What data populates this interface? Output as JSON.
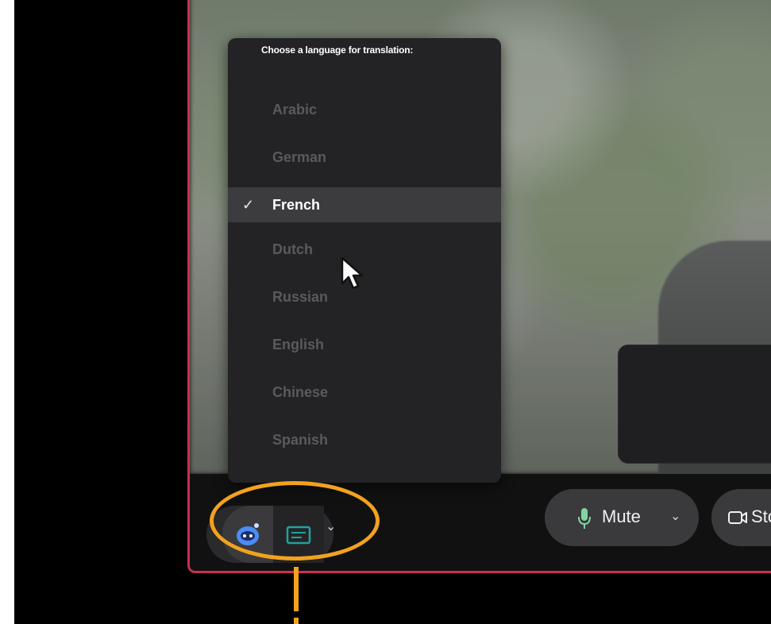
{
  "language_menu": {
    "title": "Choose a language for translation:",
    "languages": [
      {
        "label": "Arabic",
        "selected": false
      },
      {
        "label": "German",
        "selected": false
      },
      {
        "label": "French",
        "selected": true
      },
      {
        "label": "Dutch",
        "selected": false
      },
      {
        "label": "Russian",
        "selected": false
      },
      {
        "label": "English",
        "selected": false
      },
      {
        "label": "Chinese",
        "selected": false
      },
      {
        "label": "Spanish",
        "selected": false
      }
    ],
    "check_glyph": "✓"
  },
  "controls": {
    "mute_label": "Mute",
    "stop_video_label": "Sto",
    "chevron_glyph": "⌄"
  },
  "colors": {
    "window_border": "#c8314e",
    "highlight": "#f3a21d",
    "menu_bg": "#232325",
    "selected_row": "#3c3c3e",
    "ai_icon": "#4b8cf5",
    "translate_icon": "#1fa39a",
    "mic_icon": "#7fd6a3"
  },
  "icons": {
    "ai_assistant": "ai-assistant-icon",
    "translate": "translation-icon",
    "mic": "microphone-icon",
    "video": "video-camera-icon",
    "cursor": "mouse-pointer-icon"
  }
}
